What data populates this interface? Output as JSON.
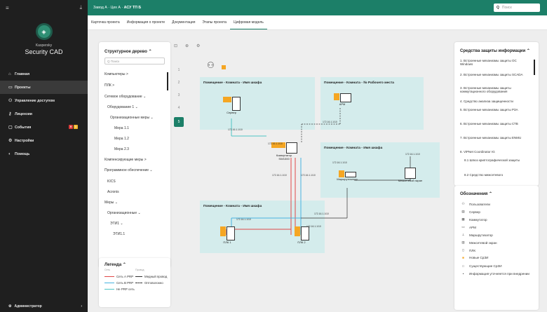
{
  "sidebar": {
    "menu_icon": "≡",
    "export_icon": "⤓",
    "brand_top": "Kaspersky",
    "brand_name": "Security CAD",
    "items": [
      {
        "label": "Главная",
        "icon": "home-icon",
        "glyph": "⌂"
      },
      {
        "label": "Проекты",
        "icon": "folder-icon",
        "glyph": "▭"
      },
      {
        "label": "Управление доступом",
        "icon": "users-icon",
        "glyph": "⚇"
      },
      {
        "label": "Лицензии",
        "icon": "key-icon",
        "glyph": "⚷"
      },
      {
        "label": "События",
        "icon": "events-icon",
        "glyph": "▢"
      },
      {
        "label": "Настройки",
        "icon": "gear-icon",
        "glyph": "⚙"
      },
      {
        "label": "Помощь",
        "icon": "help-icon",
        "glyph": "◐"
      }
    ],
    "events_badges": [
      "9",
      "1"
    ],
    "user": "Администратор",
    "user_chevron": "›"
  },
  "header": {
    "crumb1": "Завод А",
    "crumb2": "Цех А",
    "crumb3": "АСУ ТП Б",
    "sep": " · ",
    "search_placeholder": "Поиск"
  },
  "tabs": [
    "Карточка проекта",
    "Информация о проекте",
    "Документация",
    "Этапы проекта",
    "Цифровая модель"
  ],
  "tree": {
    "title": "Структурное дерево",
    "search_placeholder": "Поиск",
    "items": [
      "Компьютеры >",
      "ПЛК >",
      "Сетевое оборудование ⌄",
      "Оборудование 1 ⌄",
      "Организационные меры ⌄",
      "Мера 1.1",
      "Мера 1.2",
      "Мера 2.3",
      "Компенсирующие меры >",
      "Программное обеспечение ⌄",
      "KICS",
      "Acronis",
      "Меры ⌄",
      "Организационные ⌄",
      "ЭТИ1 ⌄",
      "ЭТИ1.1"
    ]
  },
  "ruler": [
    "1",
    "2",
    "3",
    "4",
    "5"
  ],
  "legend": {
    "title": "Легенда",
    "col1": "Сеть",
    "col2": "Провод",
    "rows": [
      {
        "label": "Сеть А PRP",
        "color": "#e04848"
      },
      {
        "label": "Сеть B PRP",
        "color": "#47b2e0"
      },
      {
        "label": "Не PRP сеть",
        "color": "#4fc4c4"
      }
    ],
    "wire1": "Медный провод",
    "wire2": "Оптоволокно"
  },
  "diagram": {
    "room1": "Помещение - Комната - Имя шкафа",
    "room2": "Помещение - Комната - № Рабочего места",
    "room3": "Помещение - Комната - Имя шкафа",
    "room4": "Помещение - Комната - Имя шкафа",
    "server": "Сервер",
    "arm": "АРМ",
    "switch1": "Коммутатор",
    "switch2": "SW1000",
    "router": "Маршрутизатор",
    "firewall": "Межсетевой экран",
    "plc1": "ПЛК 1",
    "plc2": "ПЛК 2",
    "port": "172.16.1.1/10"
  },
  "sdi": {
    "title": "Средства защиты информации",
    "items": [
      "1. Встроенные механизмы защиты ОС Windows",
      "2. Встроенные механизмы защиты SCADA",
      "3. Встроенные механизмы защиты коммутационного оборудования",
      "4. Средство анализа защищенности",
      "5. Встроенные механизмы защиты РЗА",
      "6. Встроенные механизмы защиты СТВ",
      "7. Встроенные механизмы защиты ENMU",
      "8. ViPNet Coordinator IG",
      "8.1 Шлюз криптографической защиты",
      "8.2 Средство межсетевого"
    ]
  },
  "notation": {
    "title": "Обозначения",
    "items": [
      {
        "label": "Пользователи",
        "icon": "users-icon",
        "glyph": "⚇"
      },
      {
        "label": "Сервер",
        "icon": "server-icon",
        "glyph": "▤"
      },
      {
        "label": "Коммутатор",
        "icon": "switch-icon",
        "glyph": "▦"
      },
      {
        "label": "АРМ",
        "icon": "monitor-icon",
        "glyph": "▭"
      },
      {
        "label": "Маршрутизатор",
        "icon": "router-icon",
        "glyph": "⊥"
      },
      {
        "label": "Межсетевой экран",
        "icon": "firewall-icon",
        "glyph": "▥"
      },
      {
        "label": "ПЛК",
        "icon": "plc-icon",
        "glyph": "▯"
      },
      {
        "label": "Новые СрЗИ",
        "icon": "new-sdi-icon",
        "glyph": "■"
      },
      {
        "label": "Существующие СрЗИ",
        "icon": "existing-sdi-icon",
        "glyph": "□"
      },
      {
        "label": "Информация уточняется при внедрении",
        "icon": "dot-icon",
        "glyph": "•"
      }
    ]
  },
  "colors": {
    "accent": "#1c7f68",
    "sidebar": "#1f1f1f",
    "room": "#d4ecec",
    "red": "#e04848",
    "blue": "#47b2e0",
    "teal": "#4fc4c4",
    "sdi_new": "#f5a623"
  }
}
